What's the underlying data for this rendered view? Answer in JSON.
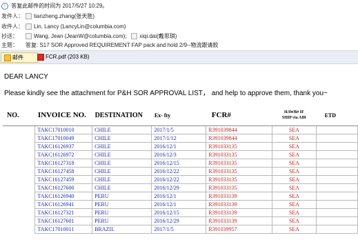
{
  "header": {
    "reply_info": "答复此邮件的时间为 2017/5/27 10:29。",
    "from_label": "发件人：",
    "from_value": "tianzheng.zhang(张天胜)",
    "to_label": "收件人：",
    "to_value": "Lin, Lancy (LancyLin@columbia.com)",
    "cc_label": "抄送：",
    "cc_value": "Wang, Jean (JeanW@columbia.com);",
    "cc_value2": "xiqi.dai(戴思琪)",
    "subject_label": "主题：",
    "subject_value": "答复: S17 SOR Approved REQUIREMENT FAP pack and hold 2/9--物流跟请款"
  },
  "tabs": {
    "mail": "邮件",
    "attachment": "FCR.pdf (203 KB)"
  },
  "body": {
    "greeting": "DEAR LANCY",
    "message": "Please kindly see the attachment for P&H SOR APPROVAL LIST， and help to approve them, thank you~"
  },
  "table": {
    "headers": {
      "no": "NO.",
      "invoice": "INVOICE NO.",
      "destination": "DESTINATION",
      "exfty": "Ex- fty",
      "fcr": "FCR#",
      "hawb_top": "HAWB# IF",
      "hawb_bottom": "SHIP via AIR",
      "etd": "ETD"
    },
    "rows": [
      {
        "invoice": "TAKC17010010",
        "dest": "CHILE",
        "exfty": "2017/1/5",
        "fcr": "R391039844",
        "ship": "SEA"
      },
      {
        "invoice": "TAKC17010049",
        "dest": "CHILE",
        "exfty": "2017/1/12",
        "fcr": "R391039844",
        "ship": "SEA"
      },
      {
        "invoice": "TAKC16126937",
        "dest": "CHILE",
        "exfty": "2016/12/1",
        "fcr": "R391033135",
        "ship": "SEA"
      },
      {
        "invoice": "TAKC16126972",
        "dest": "CHILE",
        "exfty": "2016/12/3",
        "fcr": "R391033135",
        "ship": "SEA"
      },
      {
        "invoice": "TAKC16127318",
        "dest": "CHILE",
        "exfty": "2016/12/15",
        "fcr": "R391033135",
        "ship": "SEA"
      },
      {
        "invoice": "TAKC16127458",
        "dest": "CHILE",
        "exfty": "2016/12/22",
        "fcr": "R391033135",
        "ship": "SEA"
      },
      {
        "invoice": "TAKC16127459",
        "dest": "CHILE",
        "exfty": "2016/12/22",
        "fcr": "R391033135",
        "ship": "SEA"
      },
      {
        "invoice": "TAKC16127600",
        "dest": "CHILE",
        "exfty": "2016/12/29",
        "fcr": "R391033135",
        "ship": "SEA"
      },
      {
        "invoice": "TAKC16126940",
        "dest": "PERU",
        "exfty": "2016/12/1",
        "fcr": "R391033139",
        "ship": "SEA"
      },
      {
        "invoice": "TAKC16126941",
        "dest": "PERU",
        "exfty": "2016/12/1",
        "fcr": "R391033139",
        "ship": "SEA"
      },
      {
        "invoice": "TAKC16127321",
        "dest": "PERU",
        "exfty": "2016/12/15",
        "fcr": "R391033139",
        "ship": "SEA"
      },
      {
        "invoice": "TAKC16127601",
        "dest": "PERU",
        "exfty": "2016/12/29",
        "fcr": "R391033139",
        "ship": "SEA"
      },
      {
        "invoice": "TAKC17010011",
        "dest": "BRAZIL",
        "exfty": "2017/1/5",
        "fcr": "R391039957",
        "ship": "SEA"
      }
    ]
  },
  "colors": {
    "link_blue": "#1d2bb4",
    "fcr_red": "#c0201a"
  }
}
